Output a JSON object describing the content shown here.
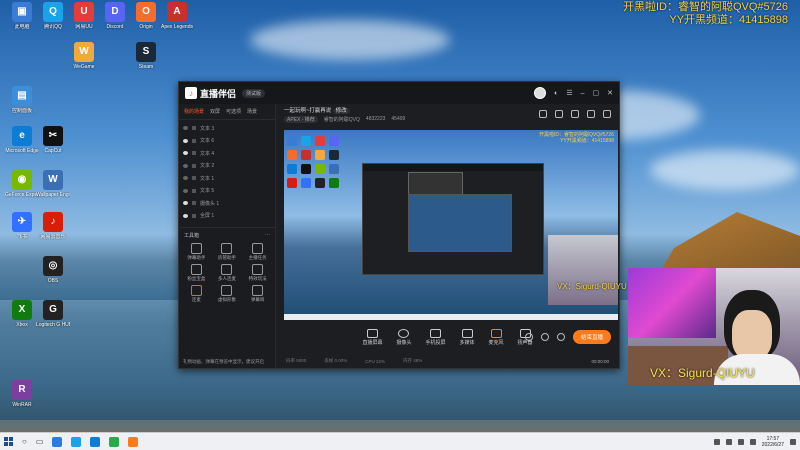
{
  "overlay": {
    "id_line": "开黑啦ID：睿智的阿聪QVQ#5726",
    "yy_line": "YY开黑频道：41415898",
    "vx_line": "VX：Sigurd-QIUYU",
    "vx_small": "VX：Sigurd-QIUYU"
  },
  "desktop_icons": [
    {
      "label": "此电脑",
      "icon": "computer-icon",
      "color": "#3a7bd5"
    },
    {
      "label": "腾讯QQ",
      "icon": "qq-icon",
      "color": "#1aa3e8"
    },
    {
      "label": "网易UU",
      "icon": "uu-icon",
      "color": "#e63b3b"
    },
    {
      "label": "Discord",
      "icon": "discord-icon",
      "color": "#5865f2"
    },
    {
      "label": "Origin",
      "icon": "origin-icon",
      "color": "#f56c2d"
    },
    {
      "label": "Apex Legends",
      "icon": "apex-icon",
      "color": "#c9302c"
    },
    {
      "label": "WeGame",
      "icon": "wegame-icon",
      "color": "#f2a93b"
    },
    {
      "label": "Steam",
      "icon": "steam-icon",
      "color": "#1b2838"
    },
    {
      "label": "控制面板",
      "icon": "control-panel-icon",
      "color": "#3a8fd8"
    },
    {
      "label": "Microsoft Edge",
      "icon": "edge-icon",
      "color": "#0c7cd5"
    },
    {
      "label": "CapCut",
      "icon": "capcut-icon",
      "color": "#111"
    },
    {
      "label": "GeForce Experience",
      "icon": "nvidia-icon",
      "color": "#76b900"
    },
    {
      "label": "Wallpaper Engine",
      "icon": "wallpaper-icon",
      "color": "#3b6fb5"
    },
    {
      "label": "网易云音乐",
      "icon": "music-icon",
      "color": "#d81e06"
    },
    {
      "label": "飞书",
      "icon": "feishu-icon",
      "color": "#3370ff"
    },
    {
      "label": "OBS",
      "icon": "obs-icon",
      "color": "#222"
    },
    {
      "label": "Xbox",
      "icon": "xbox-icon",
      "color": "#107c10"
    },
    {
      "label": "Logitech G HUB",
      "icon": "logitech-icon",
      "color": "#222"
    },
    {
      "label": "WinRAR",
      "icon": "winrar-icon",
      "color": "#7b3fa0"
    }
  ],
  "app": {
    "brand": "直播伴侣",
    "version_badge": "测试版",
    "tabs": [
      "我的场景",
      "双屏",
      "可选项",
      "场景"
    ],
    "scenes": [
      "文本 3",
      "文本 6",
      "文本 4",
      "文本 2",
      "文本 1",
      "文本 5",
      "摄像头 1",
      "全屏 1"
    ],
    "tools_title": "工具箱",
    "tools": [
      "弹幕助手",
      "房管助手",
      "主播任务",
      "粉丝宝盒",
      "多人连麦",
      "特效玩法",
      "连麦",
      "虚拟形象",
      "弹幕阅"
    ],
    "tip": "礼物动画、弹幕在预览中显示，建议开启",
    "live_title": "一起玩啊~打赢再说",
    "edit_label": "修改",
    "game_tag": "APEX - 推荐",
    "channel_name": "睿智的阿聪QVQ",
    "room_id": "4832223",
    "viewers": "45499",
    "preview_overlay_1": "开黑啦ID：睿智的阿聪QVQ#5726",
    "preview_overlay_2": "YY开黑频道：41415898",
    "bottom_buttons": [
      "直播屏幕",
      "摄像头",
      "手机投屏",
      "多媒体",
      "麦克风",
      "扬声器"
    ],
    "stop_label": "结束直播",
    "status": [
      "码率 5000",
      "丢帧 0.00%",
      "CPU 22%",
      "内存 48%"
    ],
    "timer": "00:00:00"
  },
  "taskbar": {
    "time": "17:57",
    "date": "2022/6/27"
  }
}
